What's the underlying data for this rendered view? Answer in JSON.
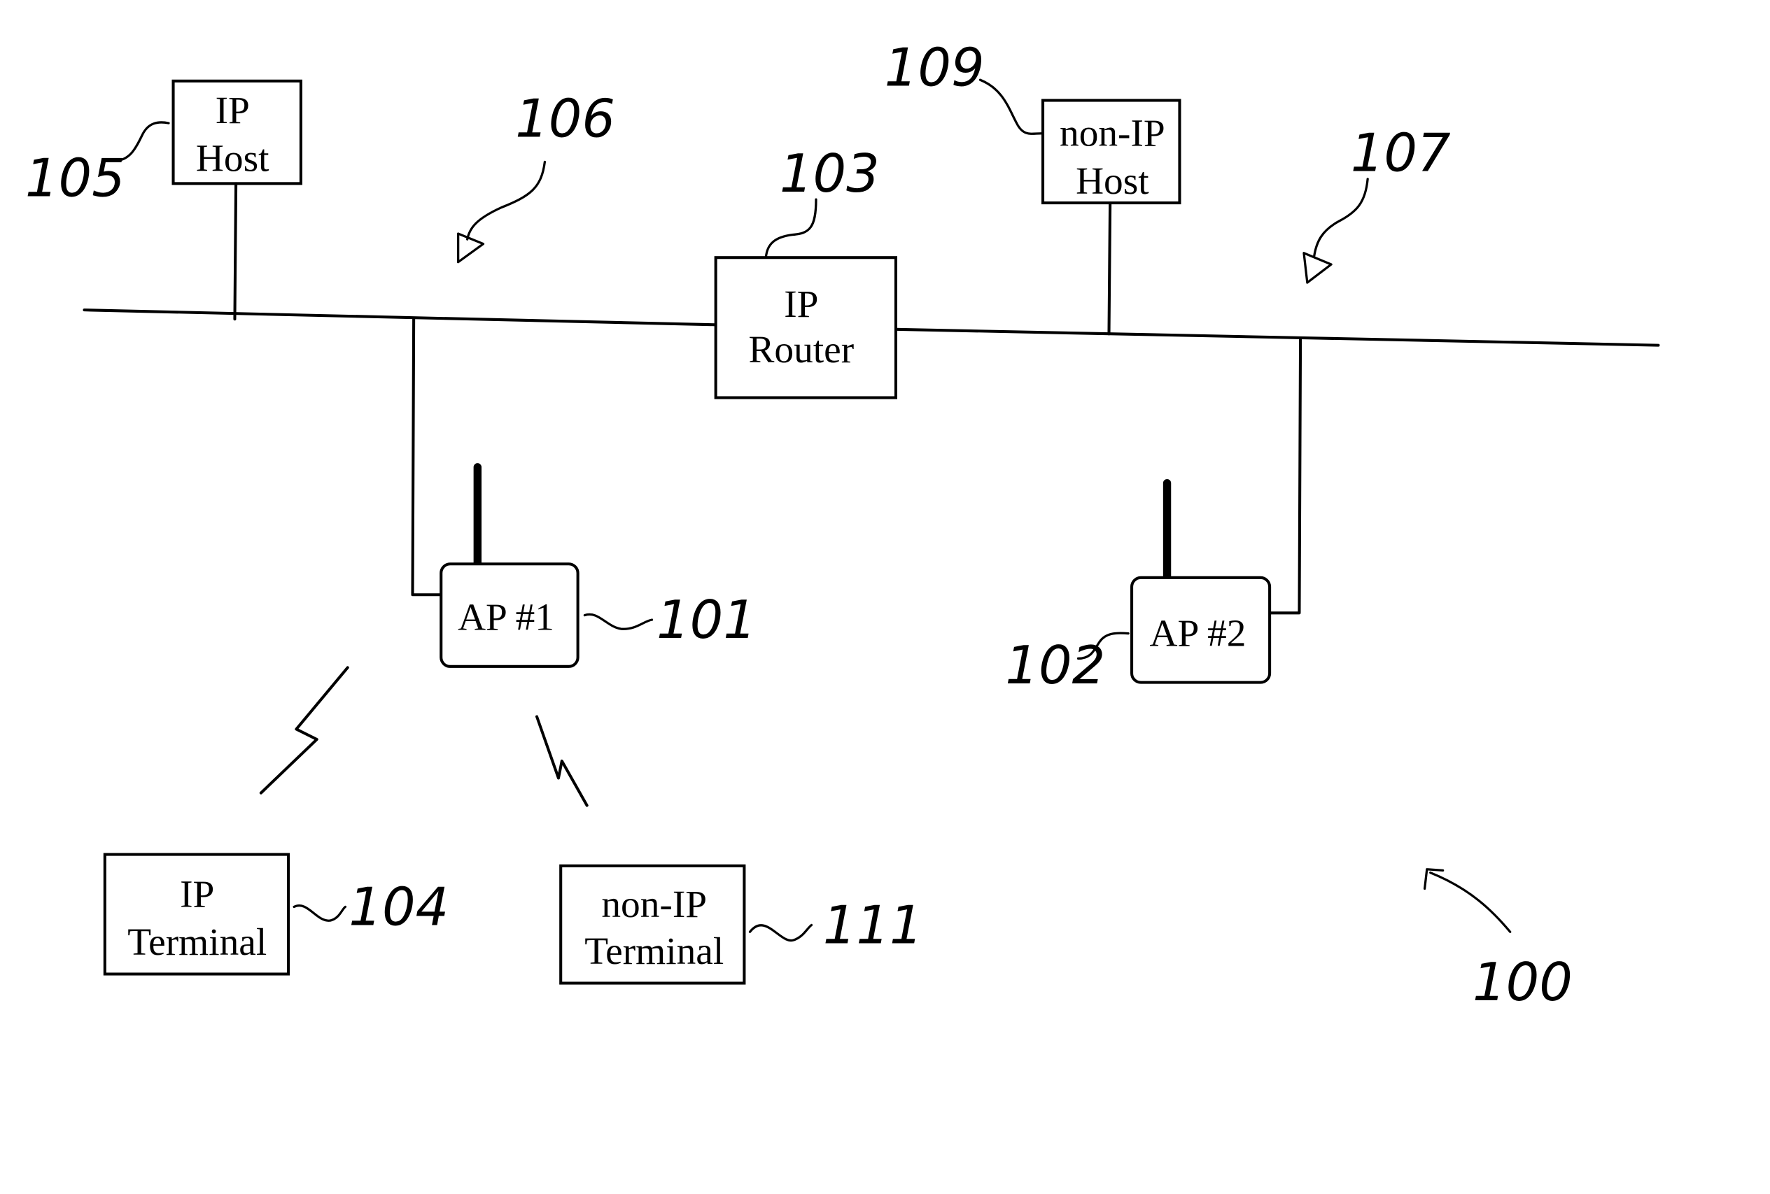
{
  "diagram": {
    "figure_ref": "100",
    "networks": [
      {
        "ref": "106"
      },
      {
        "ref": "107"
      }
    ],
    "nodes": {
      "ip_host": {
        "line1": "IP",
        "line2": "Host",
        "ref": "105"
      },
      "ip_router": {
        "line1": "IP",
        "line2": "Router",
        "ref": "103"
      },
      "non_ip_host": {
        "line1": "non-IP",
        "line2": "Host",
        "ref": "109"
      },
      "ap1": {
        "label": "AP #1",
        "ref": "101"
      },
      "ap2": {
        "label": "AP #2",
        "ref": "102"
      },
      "ip_terminal": {
        "line1": "IP",
        "line2": "Terminal",
        "ref": "104"
      },
      "non_ip_terminal": {
        "line1": "non-IP",
        "line2": "Terminal",
        "ref": "111"
      }
    }
  }
}
